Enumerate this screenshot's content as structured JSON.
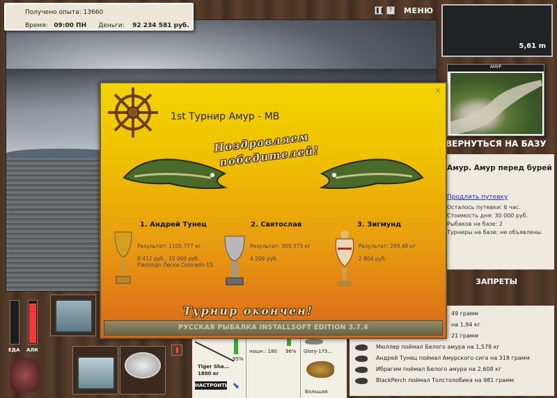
{
  "hud": {
    "exp_label": "Получено опыта:",
    "exp_value": "13660",
    "time_label": "Время:",
    "time_value": "09:00 ПН",
    "money_label": "Деньги:",
    "money_value": "92 234 581 руб."
  },
  "top_right": {
    "menu_label": "МЕНЮ",
    "pause_icon": "pause-icon",
    "help_icon": "help-icon",
    "depth": "5,61 m"
  },
  "location": {
    "map_caption": "АМУР",
    "back_button": "ВЕРНУТЬСЯ НА БАЗУ",
    "title": "Амур. Амур перед бурей",
    "extend_link": "Продлить путевку",
    "lines": [
      "Осталось путевки: 6 час.",
      "Стоимость дня: 30 000 руб.",
      "Рыбаков на базе: 2",
      "Турниры на базе: не объявлены"
    ],
    "bans_button": "ЗАПРЕТЫ"
  },
  "log": {
    "rows": [
      "49 грамм",
      "на 1,94 кг",
      "21 грамм",
      "Мюллер поймал Белого амура на 1,578 кг",
      "Андрей Тунец поймал Амурского сига на 318 грамм",
      "Ибрагим поймал Белого амура на 2,608 кг",
      "BlackPerch поймал Толстолобика на 981 грамм"
    ]
  },
  "gauges": {
    "food_label": "ЕДА",
    "alc_label": "АЛК",
    "food_level": 0.0,
    "alc_level": 0.95
  },
  "rods": {
    "percent1": "95%",
    "rod_name": "Tiger Sha...",
    "rod_weight": "1800 кг",
    "setup_button": "НАСТРОИТЬ",
    "line_label": "ношн.: 180",
    "percent2": "96%",
    "lure_name": "Glory-175...",
    "lure_size": "Большая"
  },
  "tournament": {
    "title": "1st Турнир Амур - МВ",
    "congrats_line1": "Поздравляем",
    "congrats_line2": "победителей!",
    "finished": "Турнир окончен!",
    "winners": [
      {
        "place": "1. Андрей Тунец",
        "result": "Результат: 1105,777 кг",
        "prize": "8 412 руб., 10 000 руб.",
        "extra": "Flamingo Леска Colorado-15."
      },
      {
        "place": "2. Святослав",
        "result": "Результат: 309,373 кг",
        "prize": "4 206 руб.",
        "extra": ""
      },
      {
        "place": "3. Зигмунд",
        "result": "Результат: 299,48 кг",
        "prize": "2 804 руб.",
        "extra": ""
      }
    ],
    "footer": "РУССКАЯ РЫБАЛКА INSTALLSOFT EDITION 3.7.4"
  }
}
